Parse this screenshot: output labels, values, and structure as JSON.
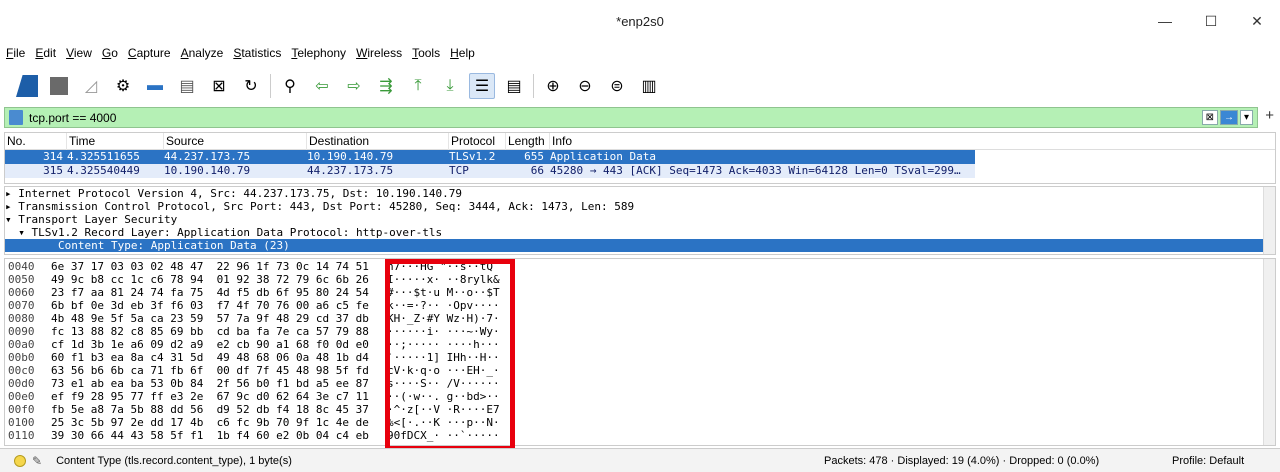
{
  "window": {
    "title": "*enp2s0",
    "minimize": "—",
    "maximize": "☐",
    "close": "✕"
  },
  "menu": [
    "File",
    "Edit",
    "View",
    "Go",
    "Capture",
    "Analyze",
    "Statistics",
    "Telephony",
    "Wireless",
    "Tools",
    "Help"
  ],
  "filter": {
    "value": "tcp.port == 4000",
    "clear": "⊠",
    "apply": "→",
    "dropdown": "▾",
    "add": "+"
  },
  "packet_list": {
    "headers": [
      "No.",
      "Time",
      "Source",
      "Destination",
      "Protocol",
      "Length",
      "Info"
    ],
    "rows": [
      {
        "no": "314",
        "time": "4.325511655",
        "src": "44.237.173.75",
        "dst": "10.190.140.79",
        "proto": "TLSv1.2",
        "len": "655",
        "info": "Application Data"
      },
      {
        "no": "315",
        "time": "4.325540449",
        "src": "10.190.140.79",
        "dst": "44.237.173.75",
        "proto": "TCP",
        "len": "66",
        "info": "45280 → 443 [ACK] Seq=1473 Ack=4033 Win=64128 Len=0 TSval=299…"
      }
    ]
  },
  "details": [
    "▸ Internet Protocol Version 4, Src: 44.237.173.75, Dst: 10.190.140.79",
    "▸ Transmission Control Protocol, Src Port: 443, Dst Port: 45280, Seq: 3444, Ack: 1473, Len: 589",
    "▾ Transport Layer Security",
    "  ▾ TLSv1.2 Record Layer: Application Data Protocol: http-over-tls",
    "        Content Type: Application Data (23)"
  ],
  "hex": [
    {
      "off": "0040",
      "bytes": "6e 37 17 03 03 02 48 47  22 96 1f 73 0c 14 74 51",
      "ascii": "n7···HG \"··s··tQ"
    },
    {
      "off": "0050",
      "bytes": "49 9c b8 cc 1c c6 78 94  01 92 38 72 79 6c 6b 26",
      "ascii": "I·····x· ··8rylk&"
    },
    {
      "off": "0060",
      "bytes": "23 f7 aa 81 24 74 fa 75  4d f5 db 6f 95 80 24 54",
      "ascii": "#···$t·u M··o··$T"
    },
    {
      "off": "0070",
      "bytes": "6b bf 0e 3d eb 3f f6 03  f7 4f 70 76 00 a6 c5 fe",
      "ascii": "k··=·?·· ·Opv····"
    },
    {
      "off": "0080",
      "bytes": "4b 48 9e 5f 5a ca 23 59  57 7a 9f 48 29 cd 37 db",
      "ascii": "KH·_Z·#Y Wz·H)·7·"
    },
    {
      "off": "0090",
      "bytes": "fc 13 88 82 c8 85 69 bb  cd ba fa 7e ca 57 79 88",
      "ascii": "······i· ···~·Wy·"
    },
    {
      "off": "00a0",
      "bytes": "cf 1d 3b 1e a6 09 d2 a9  e2 cb 90 a1 68 f0 0d e0",
      "ascii": "··;····· ····h···"
    },
    {
      "off": "00b0",
      "bytes": "60 f1 b3 ea 8a c4 31 5d  49 48 68 06 0a 48 1b d4",
      "ascii": "`·····1] IHh··H··"
    },
    {
      "off": "00c0",
      "bytes": "63 56 b6 6b ca 71 fb 6f  00 df 7f 45 48 98 5f fd",
      "ascii": "cV·k·q·o ···EH·_·"
    },
    {
      "off": "00d0",
      "bytes": "73 e1 ab ea ba 53 0b 84  2f 56 b0 f1 bd a5 ee 87",
      "ascii": "s····S·· /V······"
    },
    {
      "off": "00e0",
      "bytes": "ef f9 28 95 77 ff e3 2e  67 9c d0 62 64 3e c7 11",
      "ascii": "··(·w··. g··bd>··"
    },
    {
      "off": "00f0",
      "bytes": "fb 5e a8 7a 5b 88 dd 56  d9 52 db f4 18 8c 45 37",
      "ascii": "·^·z[··V ·R····E7"
    },
    {
      "off": "0100",
      "bytes": "25 3c 5b 97 2e dd 17 4b  c6 fc 9b 70 9f 1c 4e de",
      "ascii": "%<[·.··K ···p··N·"
    },
    {
      "off": "0110",
      "bytes": "39 30 66 44 43 58 5f f1  1b f4 60 e2 0b 04 c4 eb",
      "ascii": "90fDCX_· ··`·····"
    }
  ],
  "status": {
    "message": "Content Type (tls.record.content_type), 1 byte(s)",
    "packets": "Packets: 478 · Displayed: 19 (4.0%) · Dropped: 0 (0.0%)",
    "profile": "Profile: Default"
  }
}
